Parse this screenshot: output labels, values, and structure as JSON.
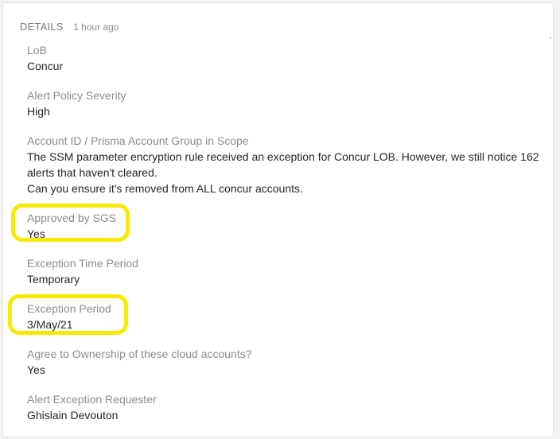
{
  "header": {
    "title": "DETAILS",
    "timestamp": "1 hour ago"
  },
  "fields": [
    {
      "label": "LoB",
      "value": "Concur"
    },
    {
      "label": "Alert Policy Severity",
      "value": "High"
    },
    {
      "label": "Account ID / Prisma Account Group in Scope",
      "value_lines": [
        "The SSM parameter encryption rule received an exception for Concur LOB. However, we still notice 162",
        "alerts that haven't cleared.",
        "Can you ensure it's removed from ALL concur accounts."
      ]
    },
    {
      "label": "Approved by SGS",
      "value": "Yes"
    },
    {
      "label": "Exception Time Period",
      "value": "Temporary"
    },
    {
      "label": "Exception Period",
      "value": "3/May/21"
    },
    {
      "label": "Agree to Ownership of these cloud accounts?",
      "value": "Yes"
    },
    {
      "label": "Alert Exception Requester",
      "value": "Ghislain Devouton"
    }
  ],
  "colors": {
    "highlight": "#f6ea00",
    "label": "#8c8c8c",
    "value": "#262626"
  }
}
